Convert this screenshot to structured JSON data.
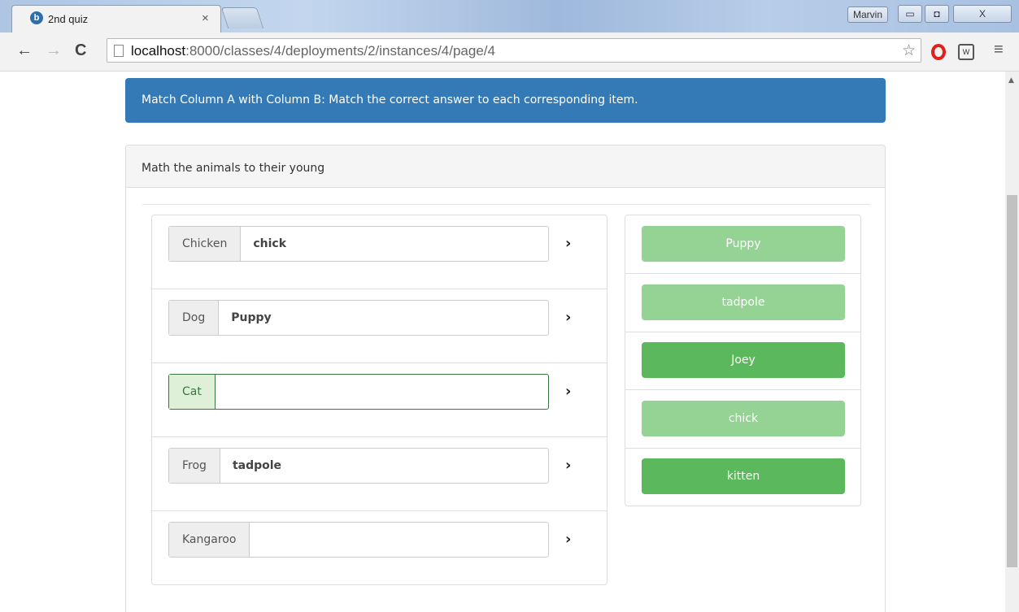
{
  "browser": {
    "tab_title": "2nd quiz",
    "tab_close": "×",
    "user_name": "Marvin",
    "url_host": "localhost",
    "url_rest": ":8000/classes/4/deployments/2/instances/4/page/4"
  },
  "icons": {
    "back": "←",
    "forward": "→",
    "reload": "C",
    "star": "☆",
    "menu": "≡",
    "chevron": "›",
    "minimize": "▭",
    "maximize": "◘",
    "close": "X",
    "favicon": "b",
    "scroll_up": "▲",
    "ext": "W"
  },
  "colors": {
    "banner": "#337ab7",
    "used_answer": "#94d394",
    "free_answer": "#5cb85c",
    "success_border": "#3c763d"
  },
  "banner": {
    "text": "Match Column A with Column B: Match the correct answer to each corresponding item."
  },
  "question": {
    "title": "Math the animals to their young"
  },
  "column_a": [
    {
      "label": "Chicken",
      "answer": "chick",
      "state": "filled"
    },
    {
      "label": "Dog",
      "answer": "Puppy",
      "state": "filled"
    },
    {
      "label": "Cat",
      "answer": "",
      "state": "active"
    },
    {
      "label": "Frog",
      "answer": "tadpole",
      "state": "filled"
    },
    {
      "label": "Kangaroo",
      "answer": "",
      "state": "empty"
    }
  ],
  "column_b": [
    {
      "label": "Puppy",
      "state": "used"
    },
    {
      "label": "tadpole",
      "state": "used"
    },
    {
      "label": "Joey",
      "state": "available"
    },
    {
      "label": "chick",
      "state": "used"
    },
    {
      "label": "kitten",
      "state": "available"
    }
  ]
}
